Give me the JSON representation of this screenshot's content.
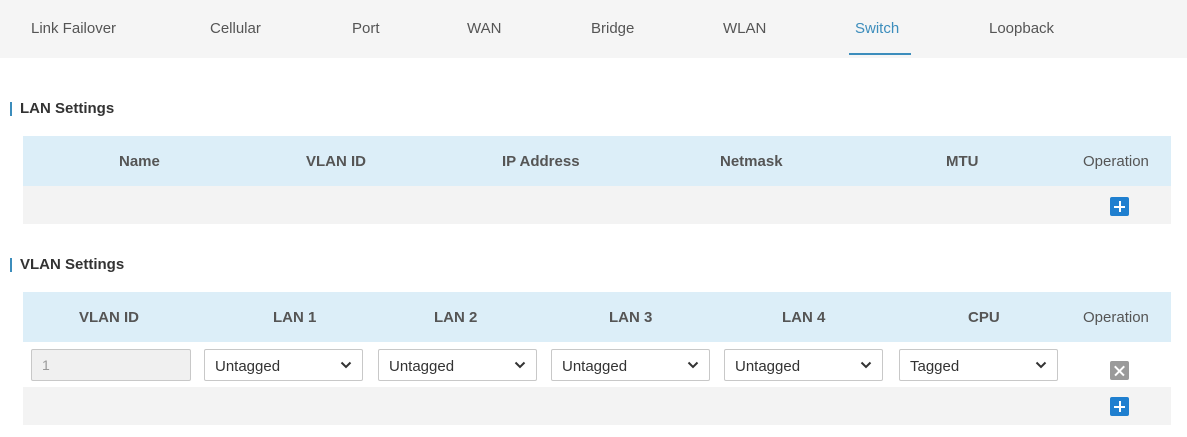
{
  "tabs": [
    "Link Failover",
    "Cellular",
    "Port",
    "WAN",
    "Bridge",
    "WLAN",
    "Switch",
    "Loopback"
  ],
  "active_tab": "Switch",
  "lan_settings": {
    "title": "LAN Settings",
    "columns": [
      "Name",
      "VLAN ID",
      "IP Address",
      "Netmask",
      "MTU",
      "Operation"
    ]
  },
  "vlan_settings": {
    "title": "VLAN Settings",
    "columns": [
      "VLAN ID",
      "LAN 1",
      "LAN 2",
      "LAN 3",
      "LAN 4",
      "CPU",
      "Operation"
    ],
    "rows": [
      {
        "vlan_id": "1",
        "lan1": "Untagged",
        "lan2": "Untagged",
        "lan3": "Untagged",
        "lan4": "Untagged",
        "cpu": "Tagged"
      }
    ]
  },
  "colors": {
    "accent": "#3c8dbc",
    "add_button": "#1f7fcf",
    "header_bg": "#dceef8"
  },
  "icons": {
    "add": "plus-icon",
    "delete": "close-icon",
    "dropdown": "chevron-down-icon"
  }
}
